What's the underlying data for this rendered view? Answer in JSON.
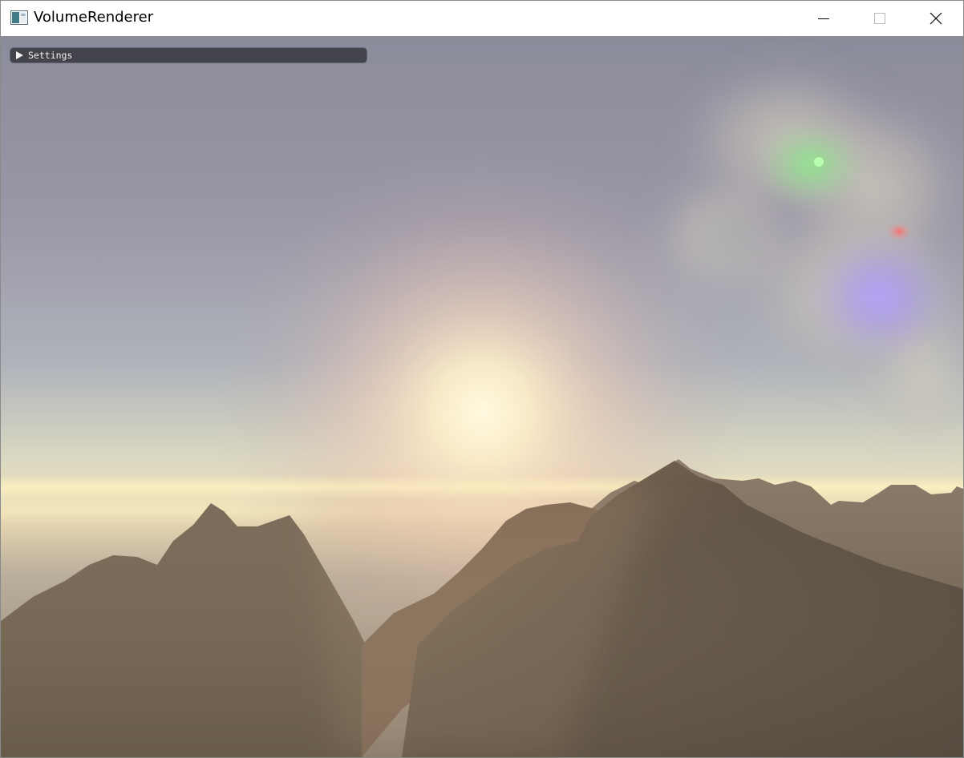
{
  "window": {
    "title": "VolumeRenderer",
    "icons": {
      "app": "app-window-icon",
      "minimize": "minimize-icon",
      "maximize": "maximize-icon",
      "close": "close-icon"
    }
  },
  "scene": {
    "colors": {
      "sky_top": "#8b8d9c",
      "sky_horizon": "#f4e7bd",
      "sun_core": "#fff6d6",
      "mountain_far": "#6f6251",
      "mountain_near": "#4a4038",
      "green_light": "#7fe28a",
      "blue_light": "#a38cff",
      "red_light": "#ff6a6a"
    }
  },
  "settings_panel": {
    "label": "Settings",
    "icon": "collapse-triangle-icon"
  }
}
